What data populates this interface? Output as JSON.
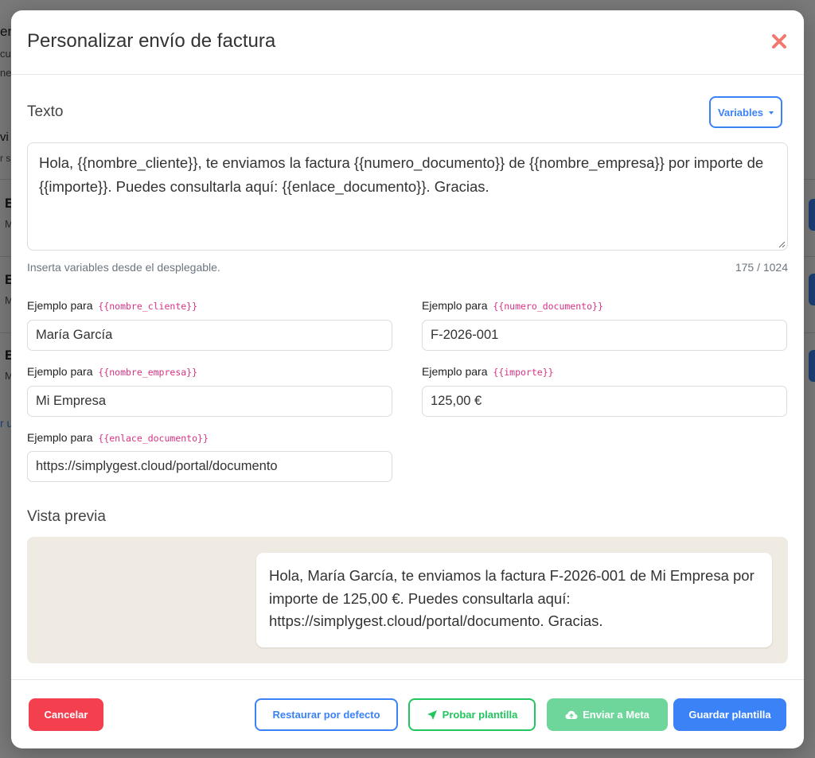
{
  "background": {
    "fragments": [
      "en",
      "cu",
      "ne",
      "vi",
      "r s",
      "E",
      "M",
      "E",
      "M",
      "E",
      "M",
      "r u"
    ]
  },
  "modal": {
    "title": "Personalizar envío de factura",
    "text_section": {
      "label": "Texto",
      "variables_button": "Variables",
      "template": "Hola, {{nombre_cliente}}, te enviamos la factura {{numero_documento}} de {{nombre_empresa}} por importe de {{importe}}. Puedes consultarla aquí: {{enlace_documento}}. Gracias.",
      "hint": "Inserta variables desde el desplegable.",
      "counter": "175 / 1024"
    },
    "examples": {
      "label_prefix": "Ejemplo para",
      "fields": [
        {
          "variable": "{{nombre_cliente}}",
          "value": "María García"
        },
        {
          "variable": "{{numero_documento}}",
          "value": "F-2026-001"
        },
        {
          "variable": "{{nombre_empresa}}",
          "value": "Mi Empresa"
        },
        {
          "variable": "{{importe}}",
          "value": "125,00 €"
        },
        {
          "variable": "{{enlace_documento}}",
          "value": "https://simplygest.cloud/portal/documento"
        }
      ]
    },
    "preview": {
      "label": "Vista previa",
      "message": "Hola, María García, te enviamos la factura F-2026-001 de Mi Empresa por importe de 125,00 €. Puedes consultarla aquí: https://simplygest.cloud/portal/documento. Gracias."
    },
    "footer": {
      "cancel": "Cancelar",
      "restore": "Restaurar por defecto",
      "test": "Probar plantilla",
      "send_meta": "Enviar a Meta",
      "save": "Guardar plantilla"
    }
  },
  "colors": {
    "primary": "#3b82f6",
    "danger": "#f43f4f",
    "success": "#22c55e",
    "success_light": "#6fd69b",
    "close": "#f07a6e",
    "variable_code": "#d63384",
    "preview_background": "#efebe3"
  },
  "icons": {
    "close": "close-icon",
    "caret": "caret-down-icon",
    "send": "paper-plane-icon",
    "cloud": "cloud-upload-icon",
    "resize": "resize-grip-icon"
  }
}
